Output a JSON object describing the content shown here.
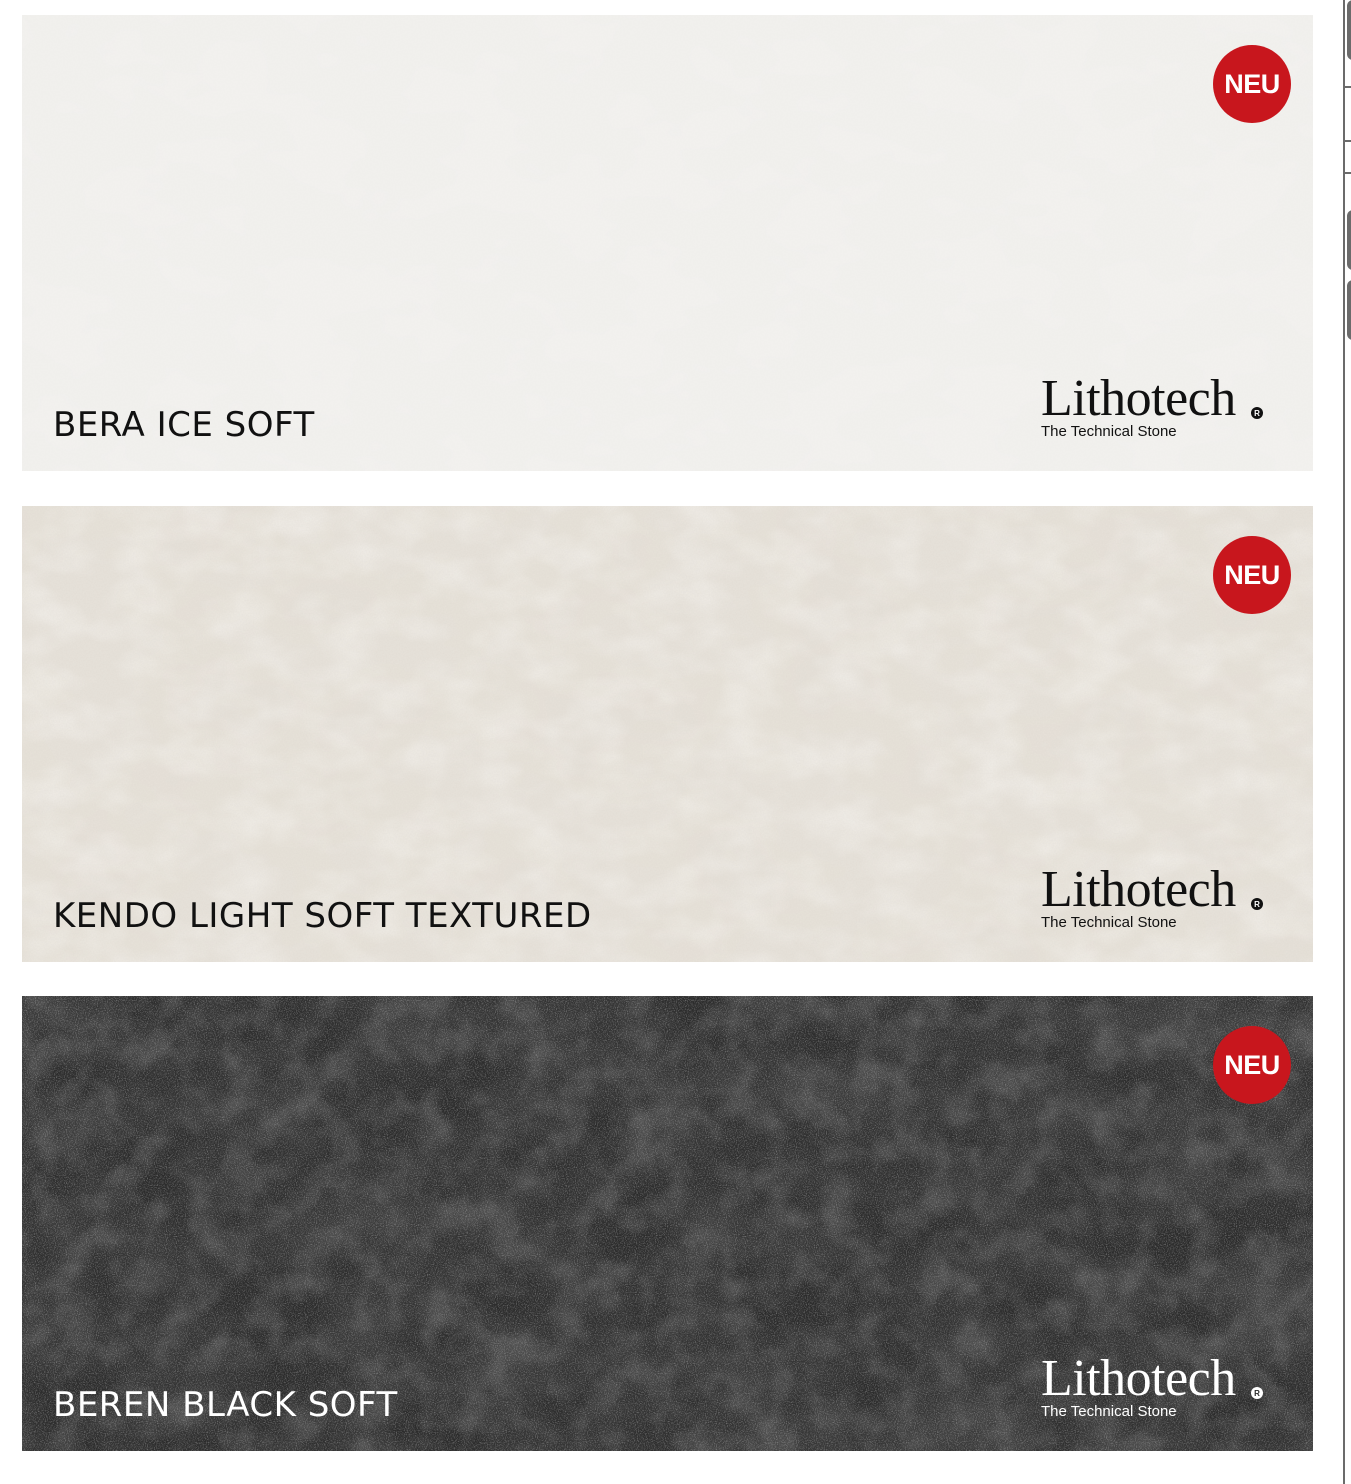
{
  "colors": {
    "badge": "#c8161d",
    "tile_1_base": "#f2f1ee",
    "tile_2_base": "#e6e1d9",
    "tile_3_base": "#2c2c2c"
  },
  "tiles": [
    {
      "badge": "NEU",
      "name": "BERA ICE SOFT",
      "logo": {
        "word": "Lithotech",
        "reg": "R",
        "tagline": "The Technical Stone"
      }
    },
    {
      "badge": "NEU",
      "name": "KENDO LIGHT SOFT TEXTURED",
      "logo": {
        "word": "Lithotech",
        "reg": "R",
        "tagline": "The Technical Stone"
      }
    },
    {
      "badge": "NEU",
      "name": "BEREN BLACK SOFT",
      "logo": {
        "word": "Lithotech",
        "reg": "R",
        "tagline": "The Technical Stone"
      }
    }
  ]
}
